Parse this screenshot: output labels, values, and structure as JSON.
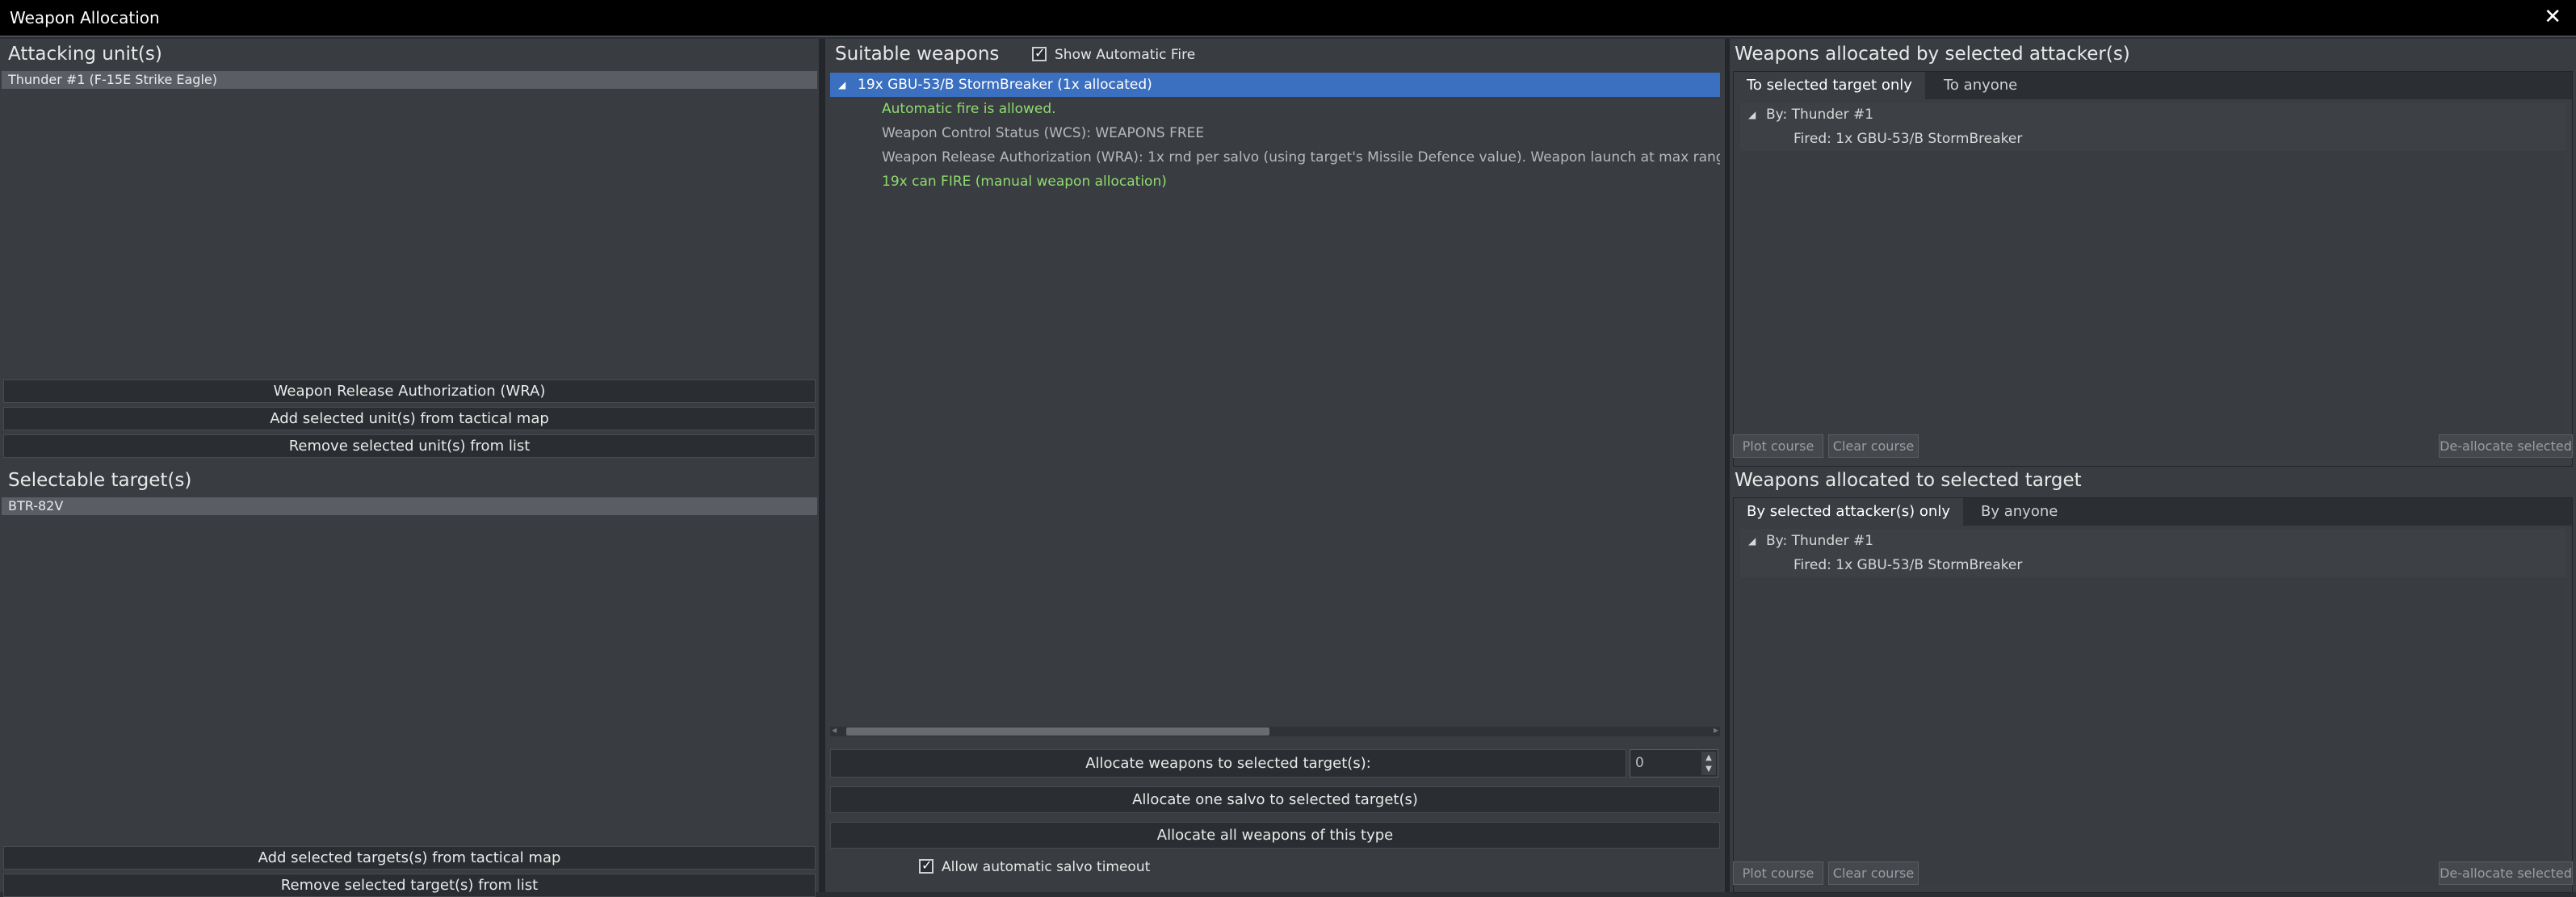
{
  "window": {
    "title": "Weapon Allocation",
    "close_glyph": "✕"
  },
  "left": {
    "attacking_title": "Attacking unit(s)",
    "attacking_units": [
      "Thunder #1 (F-15E Strike Eagle)"
    ],
    "wra_button": "Weapon Release Authorization (WRA)",
    "add_units_button": "Add selected unit(s) from tactical map",
    "remove_units_button": "Remove selected unit(s) from list",
    "targets_title": "Selectable target(s)",
    "targets": [
      "BTR-82V"
    ],
    "add_targets_button": "Add selected targets(s) from tactical map",
    "remove_targets_button": "Remove selected target(s) from list"
  },
  "middle": {
    "title": "Suitable weapons",
    "show_auto_fire_label": "Show Automatic Fire",
    "show_auto_fire_checked": true,
    "weapon_row": "19x GBU-53/B StormBreaker (1x allocated)",
    "details": [
      {
        "text": "Automatic fire is allowed.",
        "color": "green"
      },
      {
        "text": "Weapon Control Status (WCS): WEAPONS FREE",
        "color": "grey"
      },
      {
        "text": "Weapon Release Authorization (WRA): 1x rnd per salvo (using target's Missile Defence value). Weapon launch at max range.  Targ",
        "color": "grey"
      },
      {
        "text": "19x can FIRE (manual weapon allocation)",
        "color": "green"
      }
    ],
    "allocate_to_targets_label": "Allocate weapons to selected target(s):",
    "allocate_count": "0",
    "allocate_salvo_button": "Allocate one salvo to selected target(s)",
    "allocate_all_button": "Allocate all weapons of this type",
    "auto_salvo_label": "Allow automatic salvo timeout",
    "auto_salvo_checked": true
  },
  "right": {
    "by_attacker_title": "Weapons allocated by selected attacker(s)",
    "by_attacker_tabs": [
      "To selected target only",
      "To anyone"
    ],
    "by_attacker_group": "By: Thunder #1",
    "by_attacker_item": "Fired: 1x GBU-53/B StormBreaker",
    "to_target_title": "Weapons allocated to selected target",
    "to_target_tabs": [
      "By selected attacker(s) only",
      "By anyone"
    ],
    "to_target_group": "By: Thunder #1",
    "to_target_item": "Fired: 1x GBU-53/B StormBreaker",
    "plot_course": "Plot course",
    "clear_course": "Clear course",
    "deallocate": "De-allocate selected"
  }
}
